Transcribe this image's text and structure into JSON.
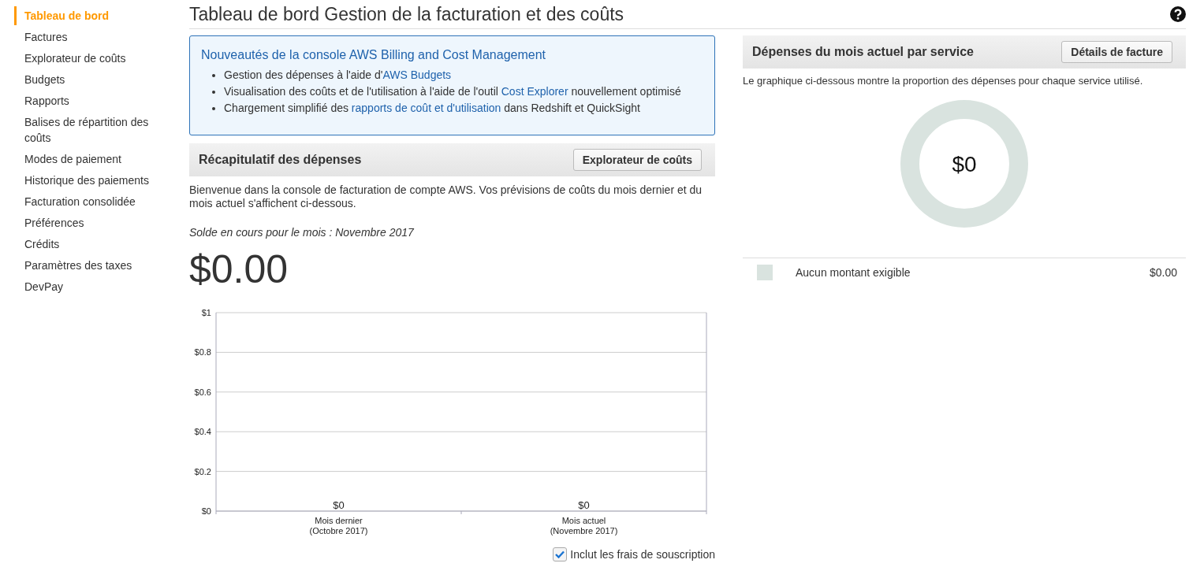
{
  "sidebar": {
    "items": [
      {
        "label": "Tableau de bord",
        "selected": true
      },
      {
        "label": "Factures",
        "selected": false
      },
      {
        "label": "Explorateur de coûts",
        "selected": false
      },
      {
        "label": "Budgets",
        "selected": false
      },
      {
        "label": "Rapports",
        "selected": false
      },
      {
        "label": "Balises de répartition des coûts",
        "selected": false
      },
      {
        "label": "Modes de paiement",
        "selected": false
      },
      {
        "label": "Historique des paiements",
        "selected": false
      },
      {
        "label": "Facturation consolidée",
        "selected": false
      },
      {
        "label": "Préférences",
        "selected": false
      },
      {
        "label": "Crédits",
        "selected": false
      },
      {
        "label": "Paramètres des taxes",
        "selected": false
      },
      {
        "label": "DevPay",
        "selected": false
      }
    ]
  },
  "page_title": "Tableau de bord Gestion de la facturation et des coûts",
  "news": {
    "title": "Nouveautés de la console AWS Billing and Cost Management",
    "items": [
      [
        {
          "text": "Gestion des dépenses à l'aide d'"
        },
        {
          "link": "AWS Budgets"
        }
      ],
      [
        {
          "text": "Visualisation des coûts et de l'utilisation à l'aide de l'outil "
        },
        {
          "link": "Cost Explorer"
        },
        {
          "text": " nouvellement optimisé"
        }
      ],
      [
        {
          "text": "Chargement simplifié des "
        },
        {
          "link": "rapports de coût et d'utilisation"
        },
        {
          "text": " dans Redshift et QuickSight"
        }
      ]
    ]
  },
  "summary": {
    "title": "Récapitulatif des dépenses",
    "button": "Explorateur de coûts",
    "intro": "Bienvenue dans la console de facturation de compte AWS. Vos prévisions de coûts du mois dernier et du mois actuel s'affichent ci-dessous.",
    "balance_label": "Solde en cours pour le mois : Novembre 2017",
    "balance": "$0.00",
    "chart_data": {
      "type": "bar",
      "categories": [
        "Mois dernier (Octobre 2017)",
        "Mois actuel (Novembre 2017)"
      ],
      "values": [
        0,
        0
      ],
      "ylim": [
        0,
        1
      ],
      "yticks": [
        {
          "value": 0,
          "label": "$0"
        },
        {
          "value": 0.2,
          "label": "$0.2"
        },
        {
          "value": 0.4,
          "label": "$0.4"
        },
        {
          "value": 0.6,
          "label": "$0.6"
        },
        {
          "value": 0.8,
          "label": "$0.8"
        },
        {
          "value": 1,
          "label": "$1"
        }
      ],
      "value_labels": [
        "$0",
        "$0"
      ],
      "grid": true
    },
    "checkbox": {
      "label": "Inclut les frais de souscription",
      "checked": true
    }
  },
  "by_service": {
    "title": "Dépenses du mois actuel par service",
    "button": "Détails de facture",
    "description": "Le graphique ci-dessous montre la proportion des dépenses pour chaque service utilisé.",
    "donut_total": "$0",
    "legend": [
      {
        "label": "Aucun montant exigible",
        "amount": "$0.00",
        "color": "#d9e3df"
      }
    ]
  }
}
